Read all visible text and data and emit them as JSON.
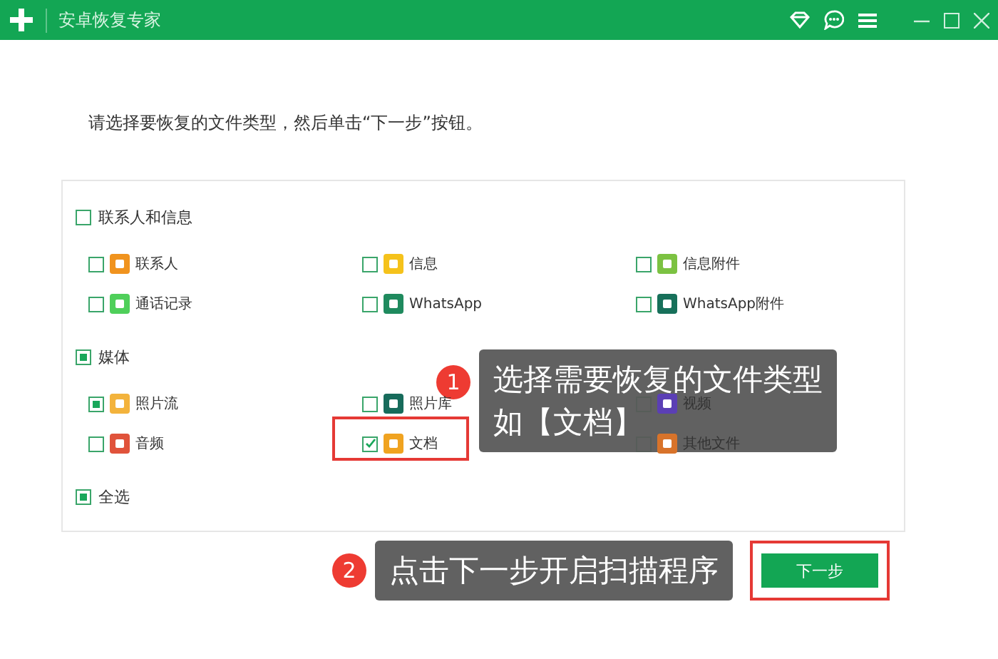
{
  "window": {
    "title": "安卓恢复专家"
  },
  "instruction": "请选择要恢复的文件类型，然后单击“下一步”按钮。",
  "groups": [
    {
      "label": "联系人和信息",
      "checked": false,
      "items": [
        {
          "label": "联系人",
          "checked": false,
          "focused": false,
          "color": "#f0931e",
          "highlighted": false
        },
        {
          "label": "信息",
          "checked": false,
          "focused": false,
          "color": "#f5c21b",
          "highlighted": false
        },
        {
          "label": "信息附件",
          "checked": false,
          "focused": false,
          "color": "#7cc242",
          "highlighted": false
        },
        {
          "label": "通话记录",
          "checked": false,
          "focused": false,
          "color": "#4fcf5a",
          "highlighted": false
        },
        {
          "label": "WhatsApp",
          "checked": false,
          "focused": false,
          "color": "#1f8a5e",
          "highlighted": false
        },
        {
          "label": "WhatsApp附件",
          "checked": false,
          "focused": false,
          "color": "#17705a",
          "highlighted": false
        }
      ]
    },
    {
      "label": "媒体",
      "checked": true,
      "items": [
        {
          "label": "照片流",
          "checked": true,
          "focused": false,
          "color": "#f3b33c",
          "highlighted": false
        },
        {
          "label": "照片库",
          "checked": false,
          "focused": false,
          "color": "#176b5b",
          "highlighted": false
        },
        {
          "label": "视频",
          "checked": false,
          "focused": false,
          "color": "#5b3fb5",
          "highlighted": false
        },
        {
          "label": "音频",
          "checked": false,
          "focused": false,
          "color": "#e0533b",
          "highlighted": false
        },
        {
          "label": "文档",
          "checked": true,
          "focused": true,
          "color": "#f0a320",
          "highlighted": true
        },
        {
          "label": "其他文件",
          "checked": false,
          "focused": false,
          "color": "#d8732a",
          "highlighted": false
        }
      ]
    }
  ],
  "select_all": {
    "label": "全选",
    "checked": true
  },
  "callouts": [
    {
      "number": "1",
      "lines": [
        "选择需要恢复的文件类型",
        "如【文档】"
      ]
    },
    {
      "number": "2",
      "lines": [
        "点击下一步开启扫描程序"
      ]
    }
  ],
  "next_button": {
    "label": "下一步",
    "highlighted": true
  }
}
